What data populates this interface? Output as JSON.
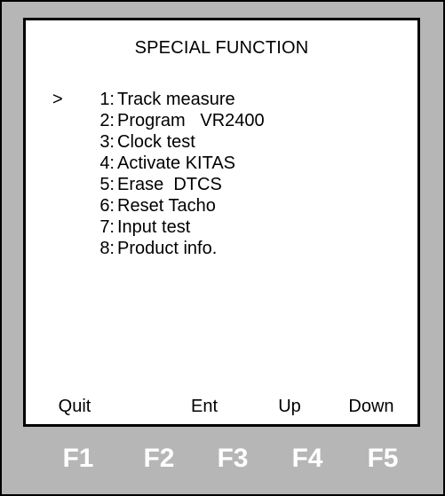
{
  "screen": {
    "title": "SPECIAL FUNCTION",
    "cursor": ">",
    "menu": [
      {
        "num": "1:",
        "label": "Track measure",
        "selected": true
      },
      {
        "num": "2:",
        "label": "Program   VR2400",
        "selected": false
      },
      {
        "num": "3:",
        "label": "Clock test",
        "selected": false
      },
      {
        "num": "4:",
        "label": "Activate KITAS",
        "selected": false
      },
      {
        "num": "5:",
        "label": "Erase  DTCS",
        "selected": false
      },
      {
        "num": "6:",
        "label": "Reset Tacho",
        "selected": false
      },
      {
        "num": "7:",
        "label": "Input test",
        "selected": false
      },
      {
        "num": "8:",
        "label": "Product info.",
        "selected": false
      }
    ],
    "softkeys": [
      "Quit",
      "",
      "Ent",
      "Up",
      "Down"
    ]
  },
  "function_keys": [
    "F1",
    "F2",
    "F3",
    "F4",
    "F5"
  ],
  "colors": {
    "device_body": "#b6b6b6",
    "screen_background": "#ffffff",
    "text": "#000000",
    "function_key_text": "#ffffff"
  }
}
